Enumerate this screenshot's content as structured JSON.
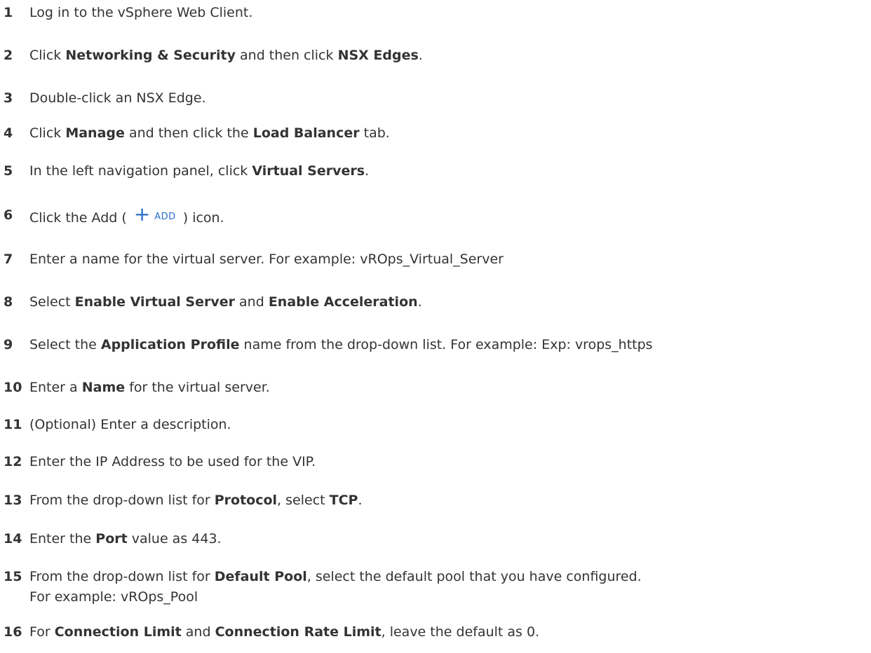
{
  "steps": [
    {
      "n": "1",
      "parts": [
        {
          "t": "Log in to the vSphere Web Client."
        }
      ]
    },
    {
      "n": "2",
      "parts": [
        {
          "t": "Click "
        },
        {
          "t": "Networking & Security",
          "b": true
        },
        {
          "t": " and then click "
        },
        {
          "t": "NSX Edges",
          "b": true
        },
        {
          "t": "."
        }
      ]
    },
    {
      "n": "3",
      "parts": [
        {
          "t": "Double-click an NSX Edge."
        }
      ]
    },
    {
      "n": "4",
      "parts": [
        {
          "t": "Click "
        },
        {
          "t": "Manage",
          "b": true
        },
        {
          "t": " and then click the "
        },
        {
          "t": "Load Balancer",
          "b": true
        },
        {
          "t": " tab."
        }
      ]
    },
    {
      "n": "5",
      "parts": [
        {
          "t": "In the left navigation panel, click "
        },
        {
          "t": "Virtual Servers",
          "b": true
        },
        {
          "t": "."
        }
      ]
    },
    {
      "n": "6",
      "parts": [
        {
          "t": "Click the Add ( "
        },
        {
          "icon": "add-icon",
          "label": "ADD"
        },
        {
          "t": " ) icon."
        }
      ]
    },
    {
      "n": "7",
      "parts": [
        {
          "t": "Enter a name for the virtual server. For example: vROps_Virtual_Server"
        }
      ]
    },
    {
      "n": "8",
      "parts": [
        {
          "t": "Select "
        },
        {
          "t": "Enable Virtual Server",
          "b": true
        },
        {
          "t": " and "
        },
        {
          "t": "Enable Acceleration",
          "b": true
        },
        {
          "t": "."
        }
      ]
    },
    {
      "n": "9",
      "parts": [
        {
          "t": "Select the "
        },
        {
          "t": "Application Profile",
          "b": true
        },
        {
          "t": " name from the drop-down list. For example: Exp: vrops_https"
        }
      ]
    },
    {
      "n": "10",
      "parts": [
        {
          "t": "Enter a "
        },
        {
          "t": "Name",
          "b": true
        },
        {
          "t": " for the virtual server."
        }
      ]
    },
    {
      "n": "11",
      "parts": [
        {
          "t": "(Optional) Enter a description."
        }
      ]
    },
    {
      "n": "12",
      "parts": [
        {
          "t": "Enter the IP Address to be used for the VIP."
        }
      ]
    },
    {
      "n": "13",
      "parts": [
        {
          "t": "From the drop-down list for "
        },
        {
          "t": "Protocol",
          "b": true
        },
        {
          "t": ", select "
        },
        {
          "t": "TCP",
          "b": true
        },
        {
          "t": "."
        }
      ]
    },
    {
      "n": "14",
      "parts": [
        {
          "t": "Enter the "
        },
        {
          "t": "Port",
          "b": true
        },
        {
          "t": " value as 443."
        }
      ]
    },
    {
      "n": "15",
      "parts": [
        {
          "t": "From the drop-down list for "
        },
        {
          "t": "Default Pool",
          "b": true
        },
        {
          "t": ", select the default pool that you have configured."
        }
      ],
      "line2": "For example: vROps_Pool"
    },
    {
      "n": "16",
      "parts": [
        {
          "t": "For "
        },
        {
          "t": "Connection Limit",
          "b": true
        },
        {
          "t": " and "
        },
        {
          "t": "Connection Rate Limit",
          "b": true
        },
        {
          "t": ", leave the default as 0."
        }
      ]
    }
  ],
  "colors": {
    "text": "#333333",
    "icon": "#2a6fc9"
  }
}
